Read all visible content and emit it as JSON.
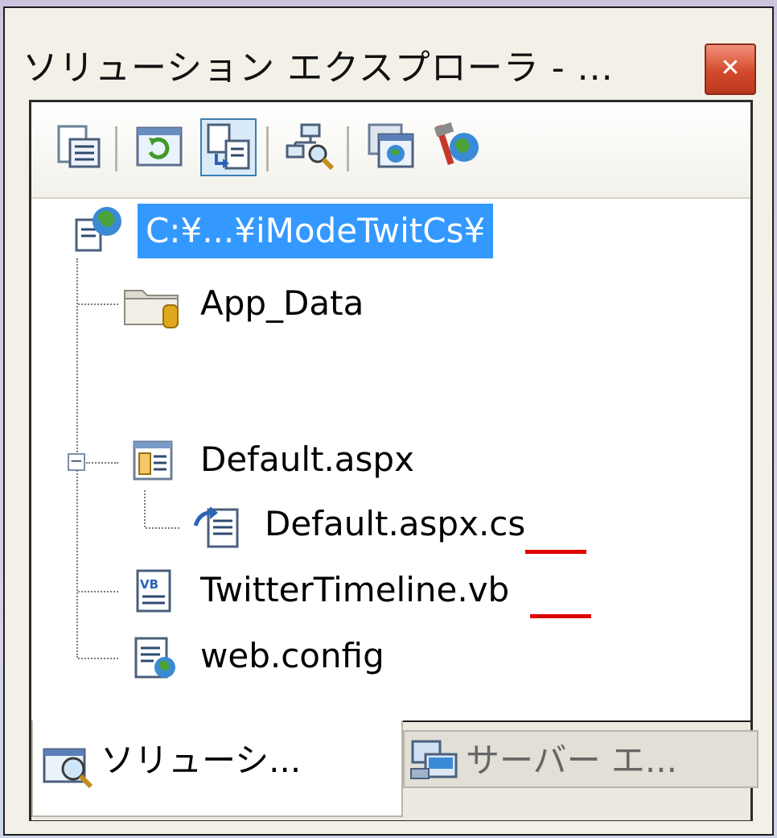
{
  "window": {
    "title": "ソリューション エクスプローラ - ...",
    "close_glyph": "✕"
  },
  "toolbar": {
    "buttons": [
      {
        "name": "properties-icon"
      },
      {
        "name": "refresh-icon"
      },
      {
        "name": "nest-related-files-icon",
        "active": true
      },
      {
        "name": "view-class-diagram-icon"
      },
      {
        "name": "asp-net-configuration-icon"
      },
      {
        "name": "copy-web-site-icon"
      }
    ]
  },
  "tree": {
    "root": {
      "label": "C:¥...¥iModeTwitCs¥",
      "icon": "web-project-icon",
      "selected": true
    },
    "items": [
      {
        "label": "App_Data",
        "icon": "data-folder-icon"
      },
      {
        "label": "Default.aspx",
        "icon": "aspx-page-icon",
        "expanded": true
      },
      {
        "label": "Default.aspx.cs",
        "icon": "code-behind-icon",
        "highlight": ".cs"
      },
      {
        "label": "TwitterTimeline.vb",
        "icon": "vb-file-icon",
        "highlight": ".vb"
      },
      {
        "label": "web.config",
        "icon": "config-file-icon"
      }
    ],
    "expander_glyph": "−"
  },
  "tabs": [
    {
      "label": "ソリューシ...",
      "icon": "solution-explorer-icon",
      "active": true
    },
    {
      "label": "サーバー エ...",
      "icon": "server-explorer-icon",
      "active": false
    }
  ],
  "colors": {
    "selection": "#3399ff",
    "highlight_underline": "#e00000",
    "close_button": "#d44a2c"
  }
}
